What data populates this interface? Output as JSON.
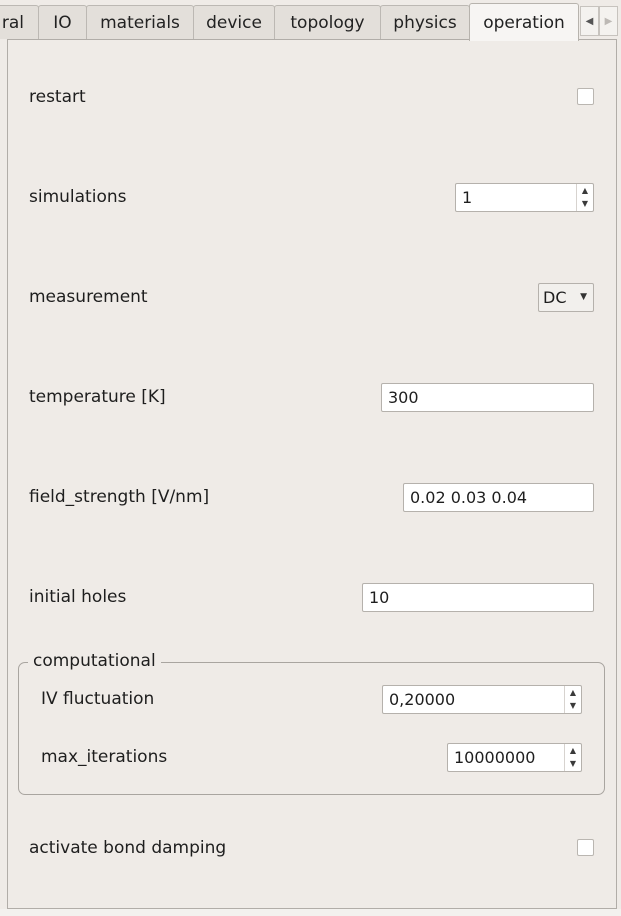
{
  "tabs": [
    {
      "label": "ral",
      "active": false
    },
    {
      "label": "IO",
      "active": false
    },
    {
      "label": "materials",
      "active": false
    },
    {
      "label": "device",
      "active": false
    },
    {
      "label": "topology",
      "active": false
    },
    {
      "label": "physics",
      "active": false
    },
    {
      "label": "operation",
      "active": true
    }
  ],
  "tab_scroll": {
    "left_icon": "triangle-left-icon",
    "right_icon": "triangle-right-icon",
    "left_glyph": "◀",
    "right_glyph": "▶"
  },
  "operation": {
    "restart": {
      "label": "restart",
      "checked": false
    },
    "simulations": {
      "label": "simulations",
      "value": "1"
    },
    "measurement": {
      "label": "measurement",
      "value": "DC"
    },
    "temperature": {
      "label": "temperature [K]",
      "value": "300"
    },
    "field_strength": {
      "label": "field_strength [V/nm]",
      "value": "0.02 0.03 0.04"
    },
    "initial_holes": {
      "label": "initial holes",
      "value": "10"
    },
    "computational": {
      "title": "computational",
      "iv_fluctuation": {
        "label": "IV fluctuation",
        "value": "0,20000"
      },
      "max_iterations": {
        "label": "max_iterations",
        "value": "10000000"
      }
    },
    "bond_damping": {
      "label": "activate bond damping",
      "checked": false
    }
  },
  "glyphs": {
    "spin_up": "▲",
    "spin_down": "▼",
    "combo_arrow": "▼"
  }
}
